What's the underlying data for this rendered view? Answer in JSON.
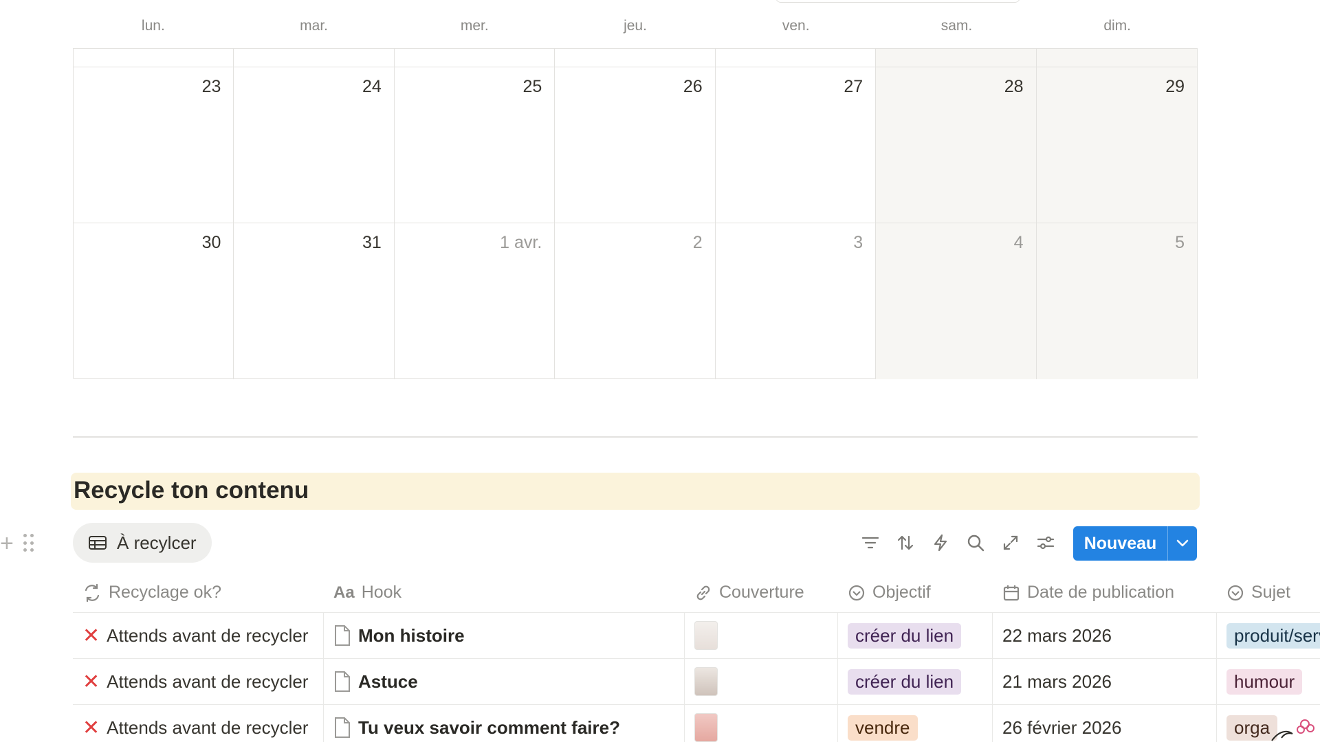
{
  "calendar": {
    "weekdays": [
      "lun.",
      "mar.",
      "mer.",
      "jeu.",
      "ven.",
      "sam.",
      "dim."
    ],
    "week1": [
      "23",
      "24",
      "25",
      "26",
      "27",
      "28",
      "29"
    ],
    "week2": [
      "30",
      "31",
      "1 avr.",
      "2",
      "3",
      "4",
      "5"
    ]
  },
  "section": {
    "title": "Recycle ton contenu"
  },
  "view": {
    "tab_label": "À recylcer"
  },
  "toolbar": {
    "new_label": "Nouveau"
  },
  "table": {
    "columns": [
      "Recyclage ok?",
      "Hook",
      "Couverture",
      "Objectif",
      "Date de publication",
      "Sujet"
    ],
    "rows": [
      {
        "status": "Attends avant de recycler",
        "hook": "Mon histoire",
        "objectif": "créer du lien",
        "date": "22 mars 2026",
        "sujet": "produit/serv"
      },
      {
        "status": "Attends avant de recycler",
        "hook": "Astuce",
        "objectif": "créer du lien",
        "date": "21 mars 2026",
        "sujet": "humour"
      },
      {
        "status": "Attends avant de recycler",
        "hook": "Tu veux savoir comment faire?",
        "objectif": "vendre",
        "date": "26 février 2026",
        "sujet": "orga"
      }
    ]
  },
  "colors": {
    "accent": "#2383e2",
    "tag_purple": "#e8deee",
    "tag_orange": "#fadec9",
    "tag_blue": "#d3e5ef",
    "tag_pink": "#f5e0e9",
    "tag_brown": "#eee0da",
    "heading_bg": "#fbf3db",
    "status_red": "#e03e3e"
  }
}
